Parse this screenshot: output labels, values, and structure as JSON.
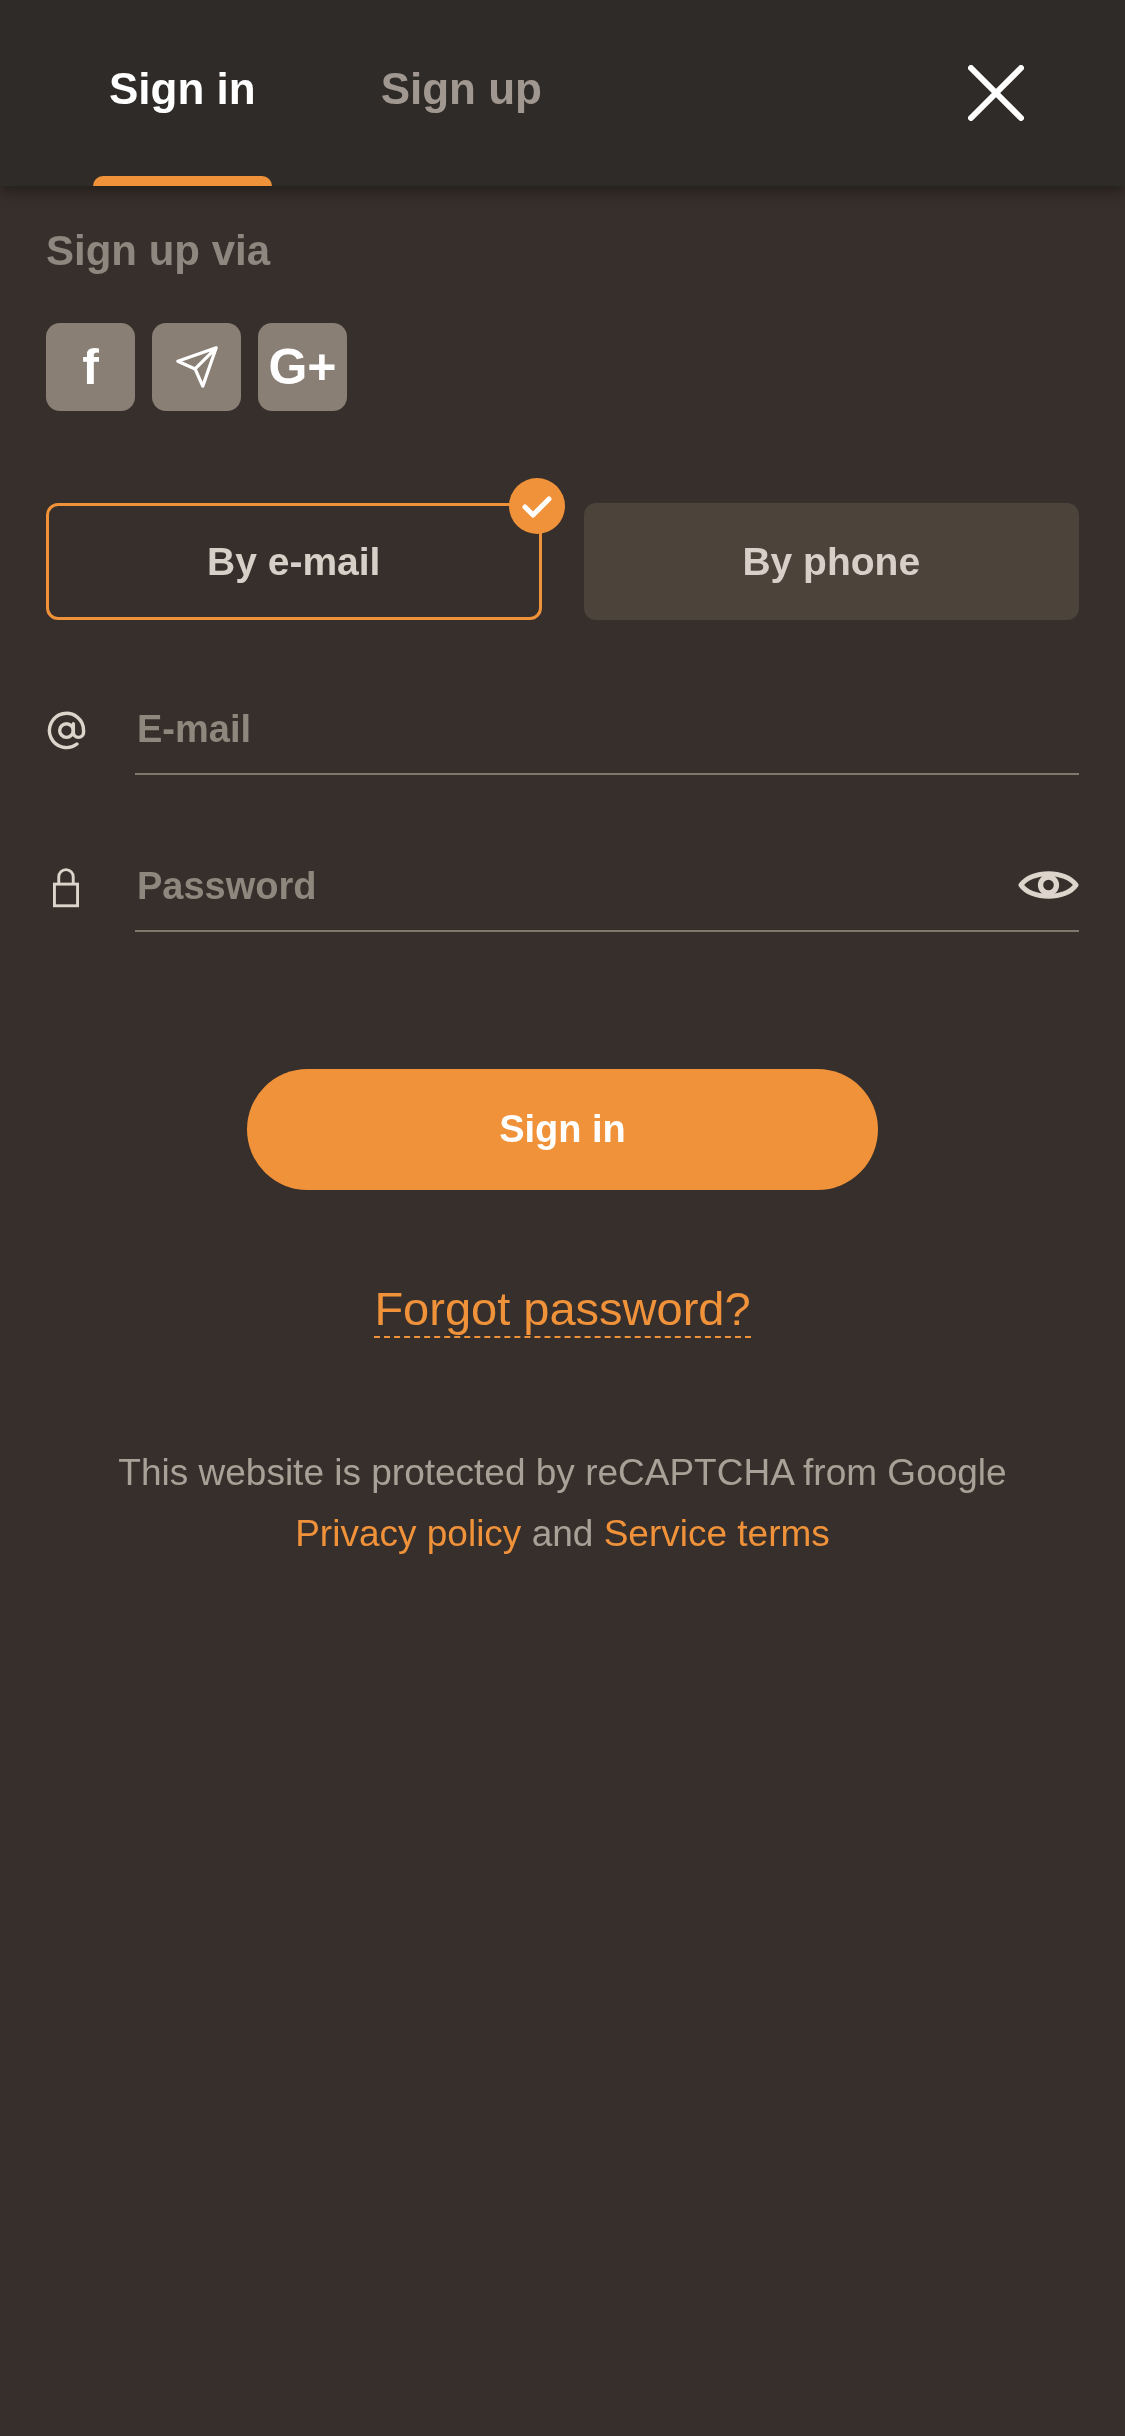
{
  "tabs": [
    {
      "label": "Sign in",
      "selected": true
    },
    {
      "label": "Sign up",
      "selected": false
    }
  ],
  "social": {
    "title": "Sign up via",
    "buttons": [
      {
        "kind": "letter",
        "label": "f"
      },
      {
        "kind": "plane"
      },
      {
        "kind": "letter",
        "label": "G+"
      }
    ]
  },
  "methods": [
    {
      "label": "By e-mail",
      "selected": true
    },
    {
      "label": "By phone",
      "selected": false
    }
  ],
  "fields": [
    {
      "kind": "email",
      "placeholder": "E-mail"
    },
    {
      "kind": "password",
      "placeholder": "Password"
    }
  ],
  "submit": {
    "label": "Sign in"
  },
  "forgot_link": "Forgot password?",
  "recaptcha": {
    "text": "This website is protected by reCAPTCHA from Google",
    "privacy_link": "Privacy policy",
    "connector": "and",
    "terms_link": "Service terms"
  }
}
